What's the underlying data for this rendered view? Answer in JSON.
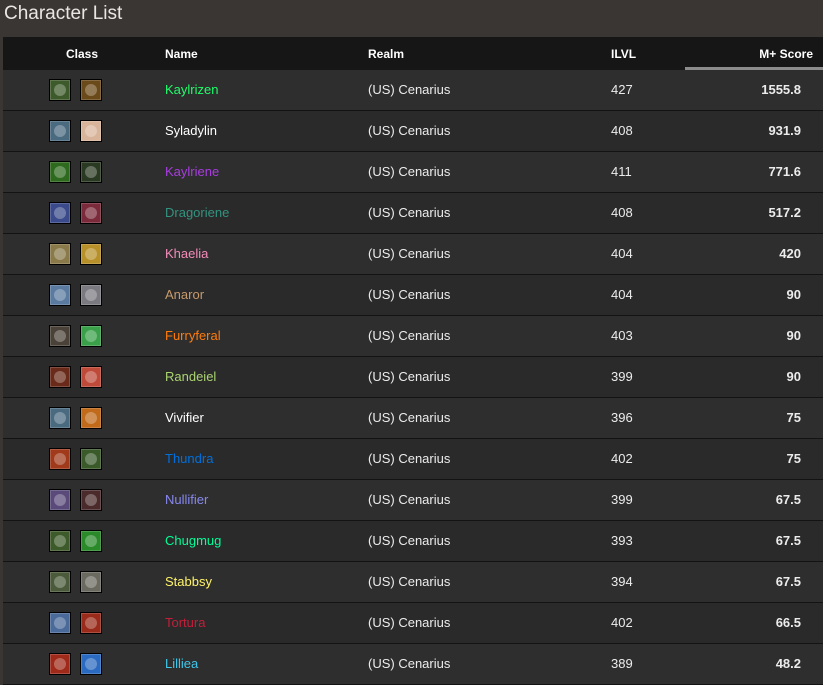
{
  "page": {
    "title": "Character List"
  },
  "columns": {
    "class": "Class",
    "name": "Name",
    "realm": "Realm",
    "ilvl": "ILVL",
    "score": "M+ Score"
  },
  "rows": [
    {
      "name": "Kaylrizen",
      "name_color": "#1eff6a",
      "realm": "(US) Cenarius",
      "ilvl": "427",
      "score": "1555.8",
      "class_icon": "monk-class-icon",
      "spec_icon": "brewmaster-spec-icon",
      "class_icon_color": "#3d5a2a",
      "spec_icon_color": "#6b4a1a"
    },
    {
      "name": "Syladylin",
      "name_color": "#ffffff",
      "realm": "(US) Cenarius",
      "ilvl": "408",
      "score": "931.9",
      "class_icon": "priest-class-icon",
      "spec_icon": "discipline-spec-icon",
      "class_icon_color": "#4a6a80",
      "spec_icon_color": "#d8b49a"
    },
    {
      "name": "Kaylriene",
      "name_color": "#a93de0",
      "realm": "(US) Cenarius",
      "ilvl": "411",
      "score": "771.6",
      "class_icon": "demon-hunter-class-icon",
      "spec_icon": "havoc-spec-icon",
      "class_icon_color": "#2e6a1e",
      "spec_icon_color": "#2a3a22"
    },
    {
      "name": "Dragoriene",
      "name_color": "#33937f",
      "realm": "(US) Cenarius",
      "ilvl": "408",
      "score": "517.2",
      "class_icon": "evoker-class-icon",
      "spec_icon": "devastation-spec-icon",
      "class_icon_color": "#3a4a8a",
      "spec_icon_color": "#7a2a3a"
    },
    {
      "name": "Khaelia",
      "name_color": "#f48cba",
      "realm": "(US) Cenarius",
      "ilvl": "404",
      "score": "420",
      "class_icon": "paladin-class-icon",
      "spec_icon": "retribution-spec-icon",
      "class_icon_color": "#8a7a4a",
      "spec_icon_color": "#b8902a"
    },
    {
      "name": "Anaror",
      "name_color": "#c69b6d",
      "realm": "(US) Cenarius",
      "ilvl": "404",
      "score": "90",
      "class_icon": "warrior-class-icon",
      "spec_icon": "protection-spec-icon",
      "class_icon_color": "#5a7aa0",
      "spec_icon_color": "#7a7a80"
    },
    {
      "name": "Furryferal",
      "name_color": "#ff7c0a",
      "realm": "(US) Cenarius",
      "ilvl": "403",
      "score": "90",
      "class_icon": "druid-class-icon",
      "spec_icon": "restoration-spec-icon",
      "class_icon_color": "#4a4238",
      "spec_icon_color": "#3aa04a"
    },
    {
      "name": "Randeiel",
      "name_color": "#aad372",
      "realm": "(US) Cenarius",
      "ilvl": "399",
      "score": "90",
      "class_icon": "hunter-class-icon",
      "spec_icon": "marksmanship-spec-icon",
      "class_icon_color": "#6a2a1a",
      "spec_icon_color": "#c04a3a"
    },
    {
      "name": "Vivifier",
      "name_color": "#ffffff",
      "realm": "(US) Cenarius",
      "ilvl": "396",
      "score": "75",
      "class_icon": "monk-class-icon",
      "spec_icon": "fire-spec-icon",
      "class_icon_color": "#4a6a80",
      "spec_icon_color": "#c06a1a"
    },
    {
      "name": "Thundra",
      "name_color": "#0070dd",
      "realm": "(US) Cenarius",
      "ilvl": "402",
      "score": "75",
      "class_icon": "shaman-class-icon",
      "spec_icon": "enhancement-spec-icon",
      "class_icon_color": "#a03a1a",
      "spec_icon_color": "#3a5a2a"
    },
    {
      "name": "Nullifier",
      "name_color": "#8788ee",
      "realm": "(US) Cenarius",
      "ilvl": "399",
      "score": "67.5",
      "class_icon": "warlock-class-icon",
      "spec_icon": "demonology-spec-icon",
      "class_icon_color": "#5a4a7a",
      "spec_icon_color": "#4a2a2a"
    },
    {
      "name": "Chugmug",
      "name_color": "#00ff98",
      "realm": "(US) Cenarius",
      "ilvl": "393",
      "score": "67.5",
      "class_icon": "monk-class-icon",
      "spec_icon": "mistweaver-spec-icon",
      "class_icon_color": "#3d5a2a",
      "spec_icon_color": "#2a8a2a"
    },
    {
      "name": "Stabbsy",
      "name_color": "#fff468",
      "realm": "(US) Cenarius",
      "ilvl": "394",
      "score": "67.5",
      "class_icon": "rogue-class-icon",
      "spec_icon": "outlaw-spec-icon",
      "class_icon_color": "#4a5a3a",
      "spec_icon_color": "#6a6a60"
    },
    {
      "name": "Tortura",
      "name_color": "#c41e3a",
      "realm": "(US) Cenarius",
      "ilvl": "402",
      "score": "66.5",
      "class_icon": "death-knight-class-icon",
      "spec_icon": "blood-spec-icon",
      "class_icon_color": "#4a6a9a",
      "spec_icon_color": "#9a2a1a"
    },
    {
      "name": "Lilliea",
      "name_color": "#3fc7eb",
      "realm": "(US) Cenarius",
      "ilvl": "389",
      "score": "48.2",
      "class_icon": "mage-class-icon",
      "spec_icon": "frost-spec-icon",
      "class_icon_color": "#a02a1a",
      "spec_icon_color": "#2a6ac0"
    }
  ]
}
